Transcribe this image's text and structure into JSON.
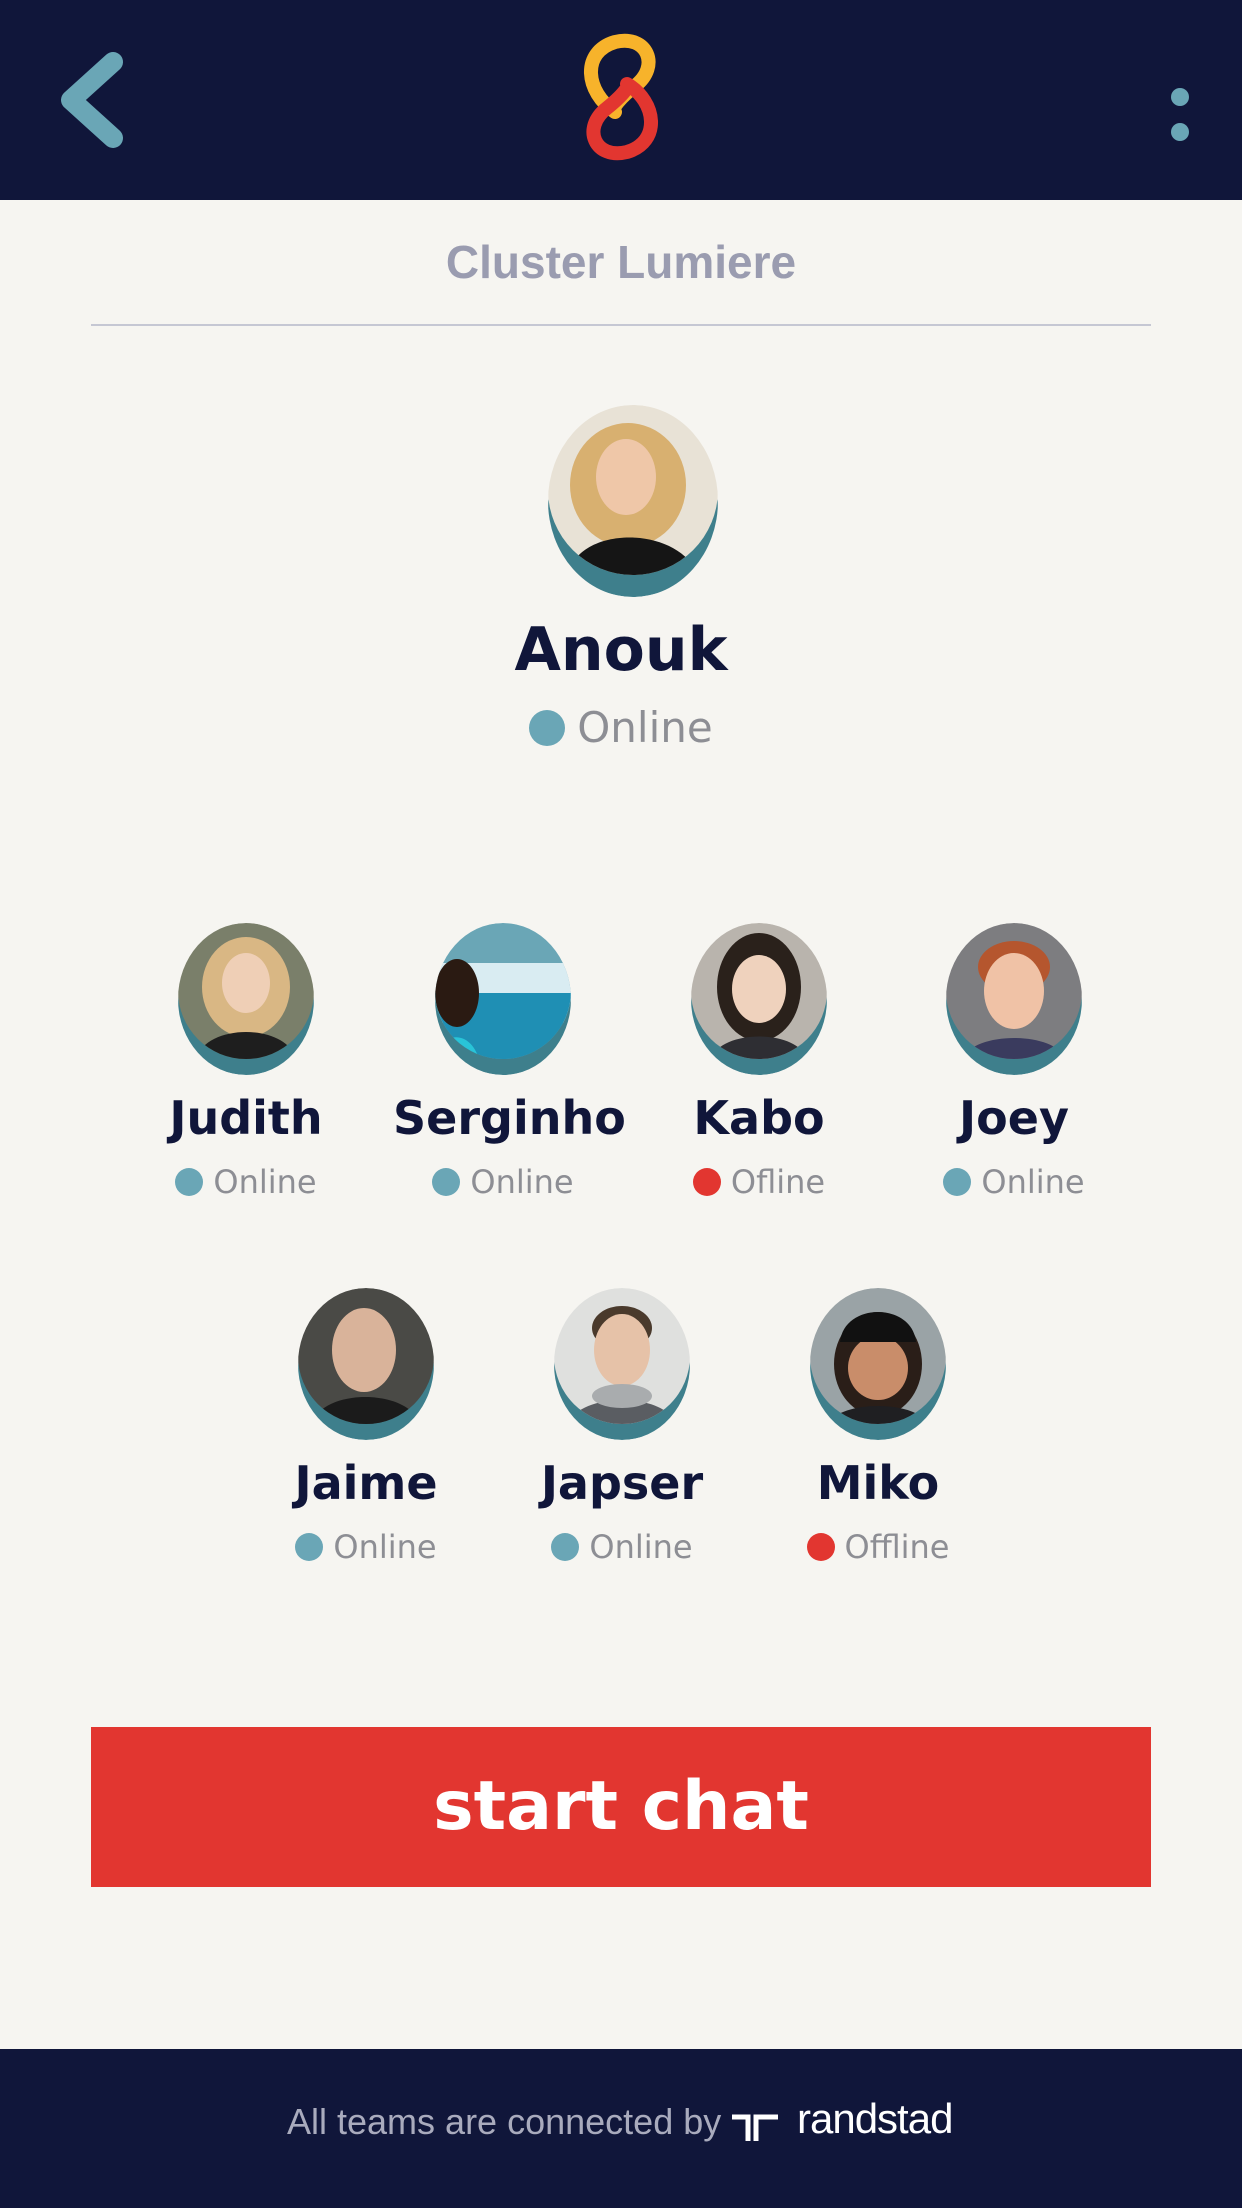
{
  "header": {
    "back_icon": "chevron-left-icon",
    "logo_icon": "linked-s-logo-icon",
    "menu_icon": "vertical-dots-icon"
  },
  "cluster": {
    "title": "Cluster Lumiere"
  },
  "lead": {
    "name": "Anouk",
    "status": "Online",
    "online": true
  },
  "members_row1": [
    {
      "name": "Judith",
      "status": "Online",
      "online": true
    },
    {
      "name": "Serginho",
      "status": "Online",
      "online": true
    },
    {
      "name": "Kabo",
      "status": "Ofline",
      "online": false
    },
    {
      "name": "Joey",
      "status": "Online",
      "online": true
    }
  ],
  "members_row2": [
    {
      "name": "Jaime",
      "status": "Online",
      "online": true
    },
    {
      "name": "Japser",
      "status": "Online",
      "online": true
    },
    {
      "name": "Miko",
      "status": "Offline",
      "online": false
    }
  ],
  "actions": {
    "start_chat_label": "start chat"
  },
  "footer": {
    "tagline": "All teams are connected by",
    "brand": "randstad"
  },
  "colors": {
    "navy": "#10163a",
    "accent_teal": "#6aa6b6",
    "online": "#6aa6b6",
    "offline": "#e23630",
    "button_red": "#e23630",
    "background": "#f6f5f1"
  }
}
